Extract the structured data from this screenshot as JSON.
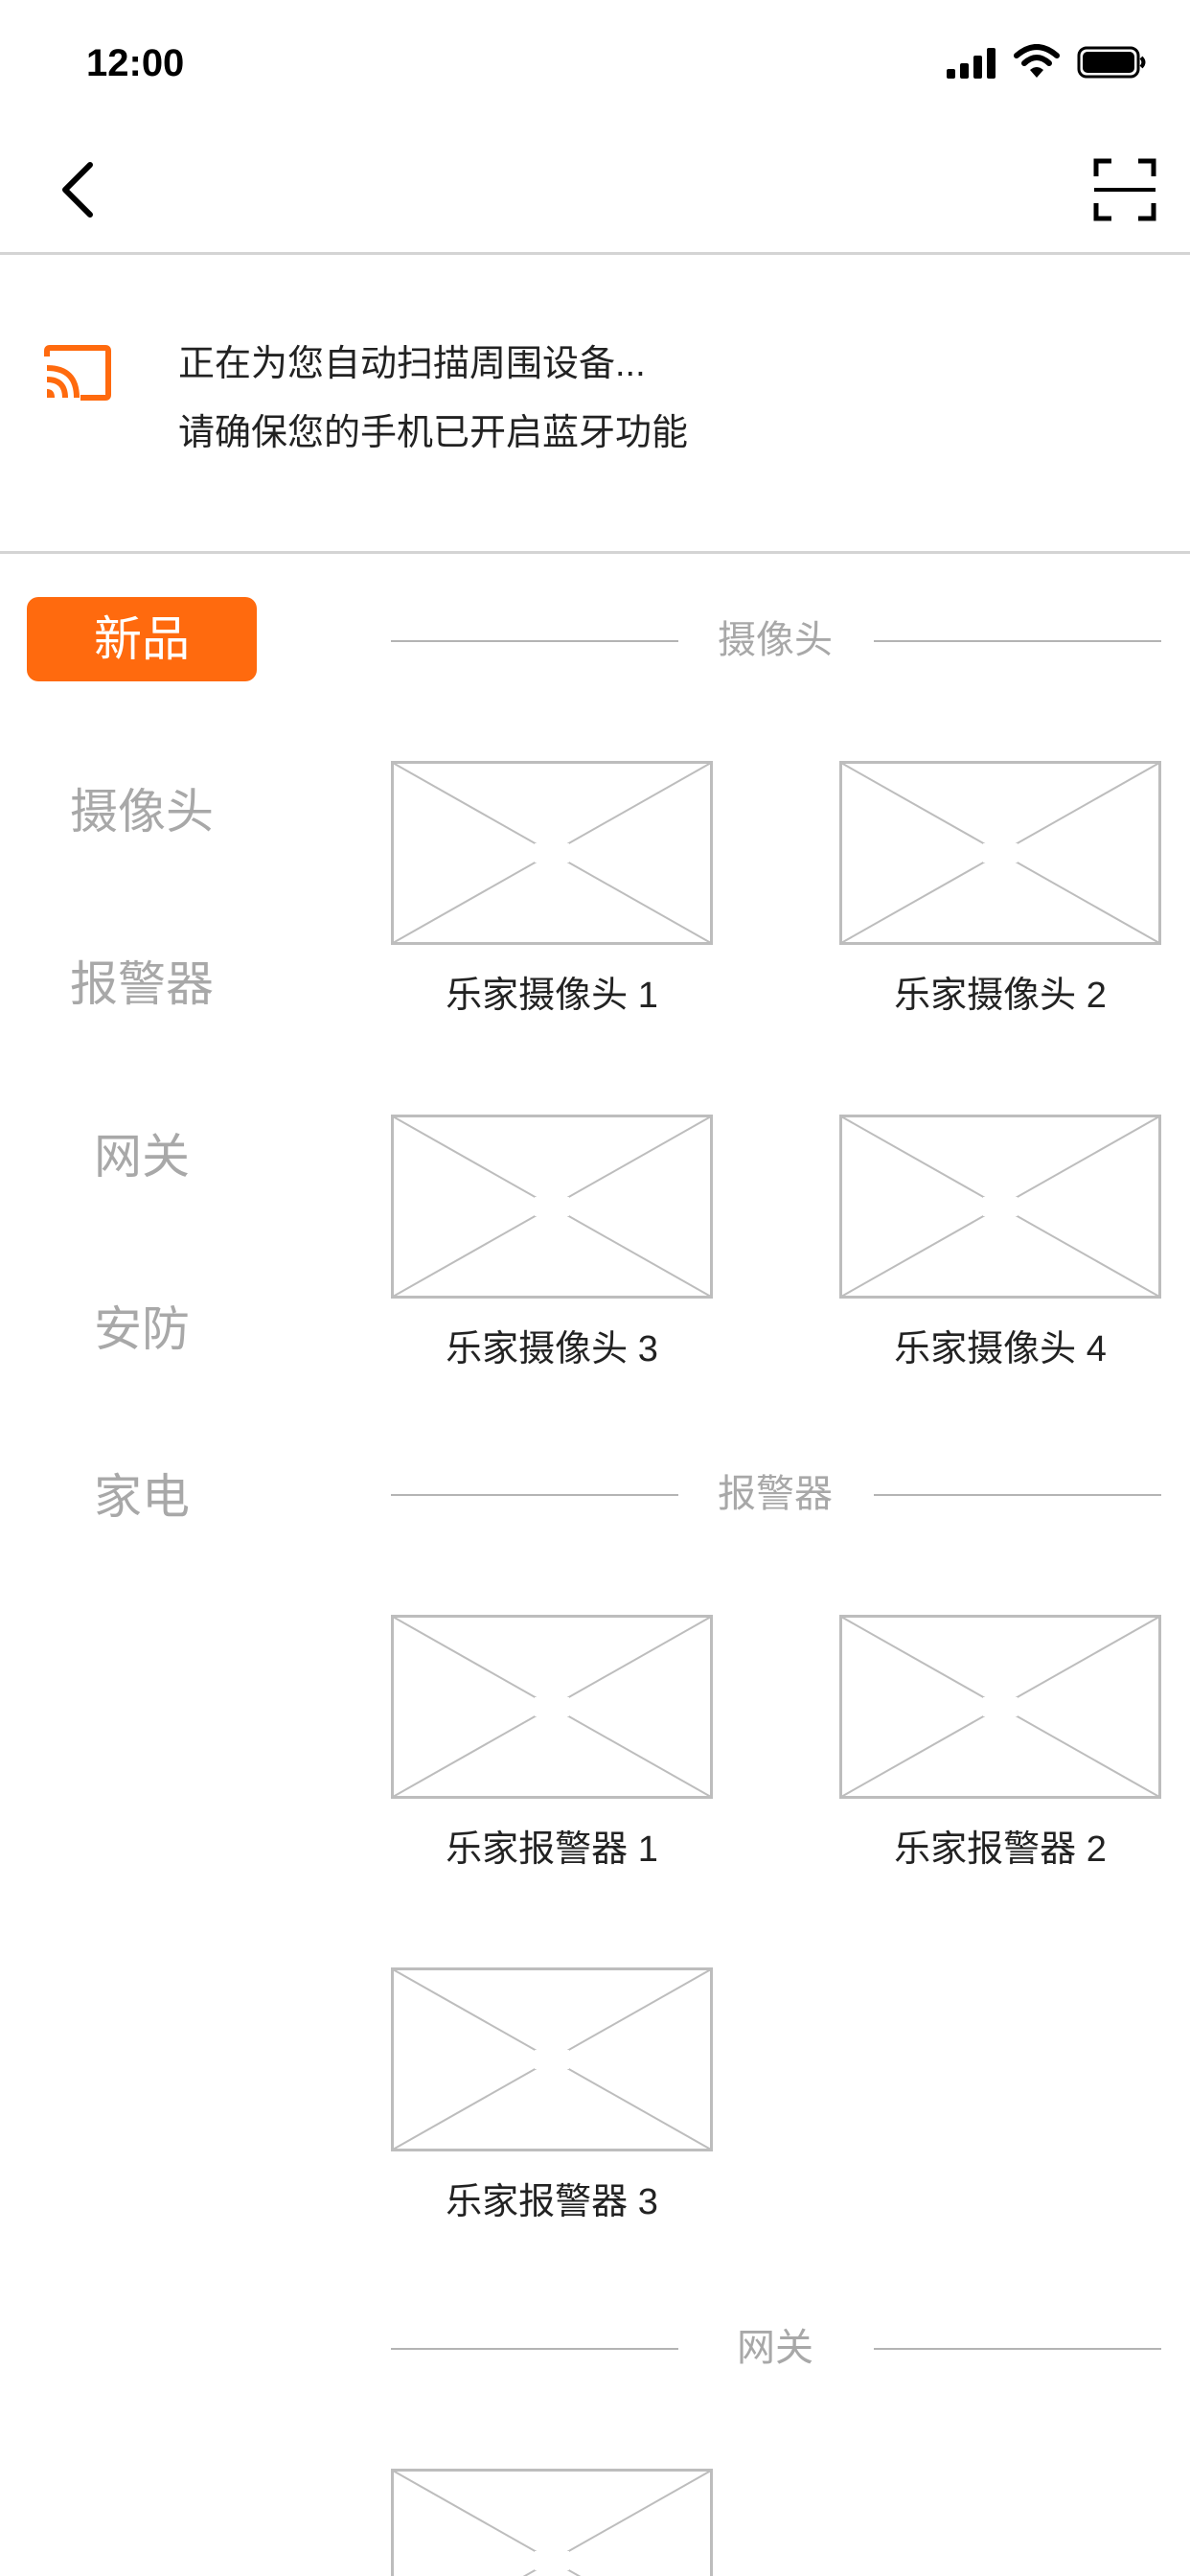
{
  "status_bar": {
    "time": "12:00",
    "icons": [
      "signal-icon",
      "wifi-icon",
      "battery-icon"
    ]
  },
  "nav": {
    "back_icon": "chevron-left-icon",
    "scan_icon": "scan-frame-icon"
  },
  "notice": {
    "icon": "cast-icon",
    "line1": "正在为您自动扫描周围设备...",
    "line2": "请确保您的手机已开启蓝牙功能"
  },
  "colors": {
    "accent": "#ff6a0e",
    "muted_text": "#a8a8a8",
    "divider": "#d4d4d4"
  },
  "sidebar": {
    "items": [
      {
        "label": "新品",
        "active": true
      },
      {
        "label": "摄像头",
        "active": false
      },
      {
        "label": "报警器",
        "active": false
      },
      {
        "label": "网关",
        "active": false
      },
      {
        "label": "安防",
        "active": false
      },
      {
        "label": "家电",
        "active": false
      }
    ]
  },
  "sections": [
    {
      "title": "摄像头",
      "products": [
        {
          "name": "乐家摄像头 1"
        },
        {
          "name": "乐家摄像头 2"
        },
        {
          "name": "乐家摄像头 3"
        },
        {
          "name": "乐家摄像头 4"
        }
      ]
    },
    {
      "title": "报警器",
      "products": [
        {
          "name": "乐家报警器 1"
        },
        {
          "name": "乐家报警器 2"
        },
        {
          "name": "乐家报警器 3"
        }
      ]
    },
    {
      "title": "网关",
      "products": [
        {
          "name": ""
        }
      ]
    }
  ]
}
